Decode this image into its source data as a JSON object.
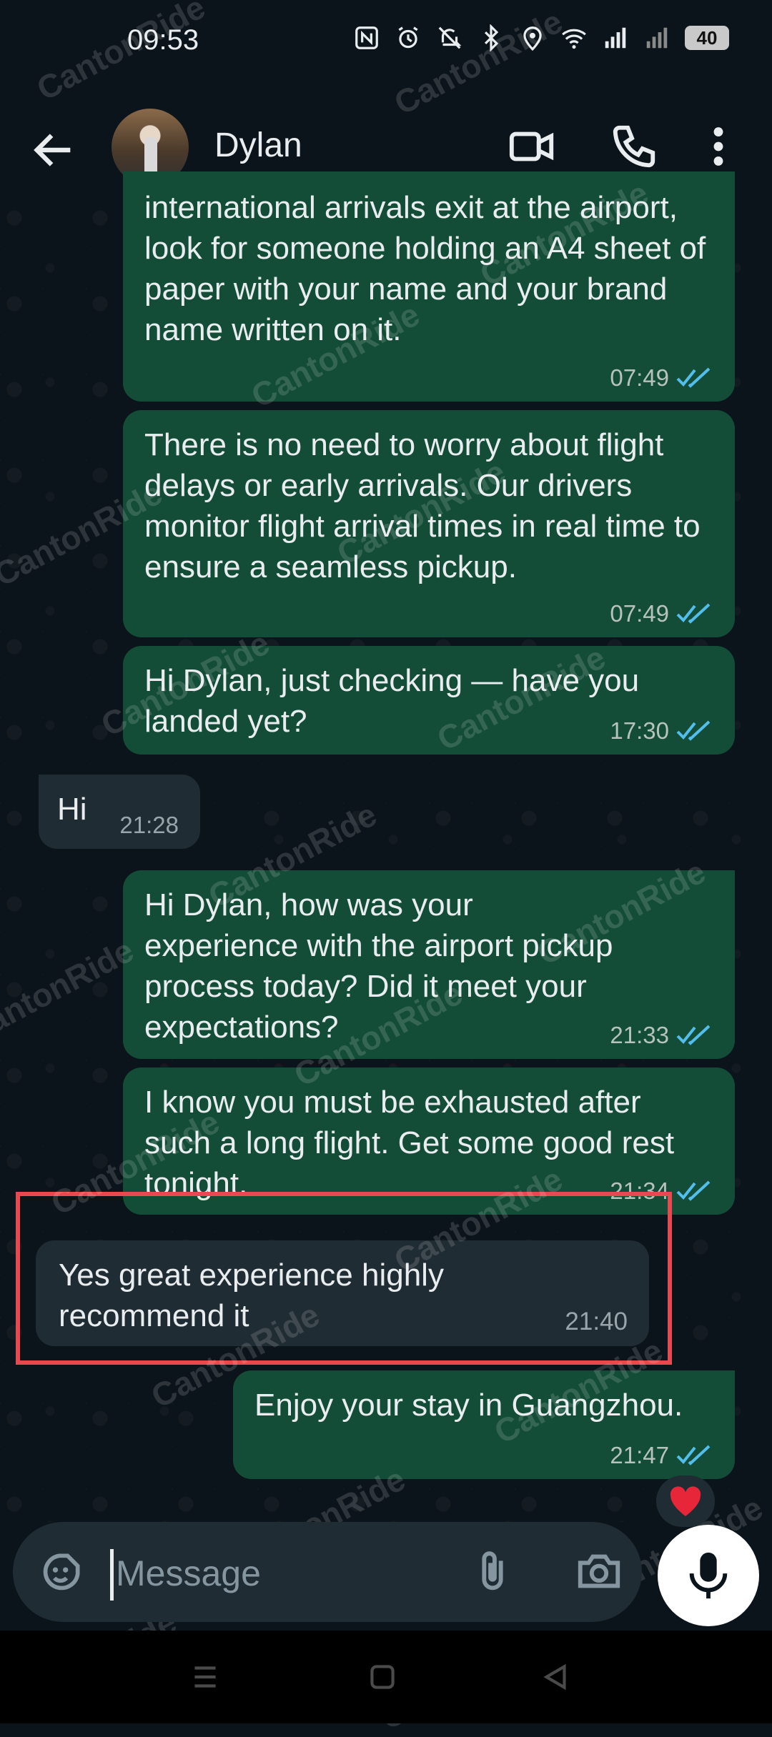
{
  "status_bar": {
    "time": "09:53",
    "battery": "40",
    "icons": [
      "nfc-icon",
      "alarm-icon",
      "mute-icon",
      "bluetooth-icon",
      "location-icon",
      "wifi-icon",
      "signal-5g-icon",
      "signal-icon"
    ]
  },
  "header": {
    "contact_name": "Dylan"
  },
  "messages": [
    {
      "text": "international arrivals exit at the airport, look for someone holding an A4 sheet of paper with your name and your brand name written on it.",
      "time": "07:49",
      "direction": "out"
    },
    {
      "text": "There is no need to worry about flight delays or early arrivals. Our drivers monitor flight arrival times in real time to ensure a seamless pickup.",
      "time": "07:49",
      "direction": "out"
    },
    {
      "text": "Hi Dylan, just checking — have you landed yet?",
      "time": "17:30",
      "direction": "out"
    },
    {
      "text": "Hi",
      "time": "21:28",
      "direction": "in"
    },
    {
      "text": "Hi Dylan, how was your experience with the airport pickup process today? Did it meet your expectations?",
      "time": "21:33",
      "direction": "out"
    },
    {
      "text": "I know you must be exhausted after such a long flight. Get some good rest tonight.",
      "time": "21:34",
      "direction": "out"
    },
    {
      "text": "Yes great experience highly recommend it",
      "time": "21:40",
      "direction": "in"
    },
    {
      "text": "Enjoy your stay in Guangzhou.",
      "time": "21:47",
      "direction": "out"
    }
  ],
  "reaction": "heart",
  "input": {
    "placeholder": "Message"
  },
  "watermark": "CantonRide",
  "colors": {
    "background": "#0b141a",
    "outgoing_bubble": "#144d37",
    "incoming_bubble": "#202c33",
    "read_ticks": "#53bdeb",
    "highlight": "#e8484f"
  }
}
